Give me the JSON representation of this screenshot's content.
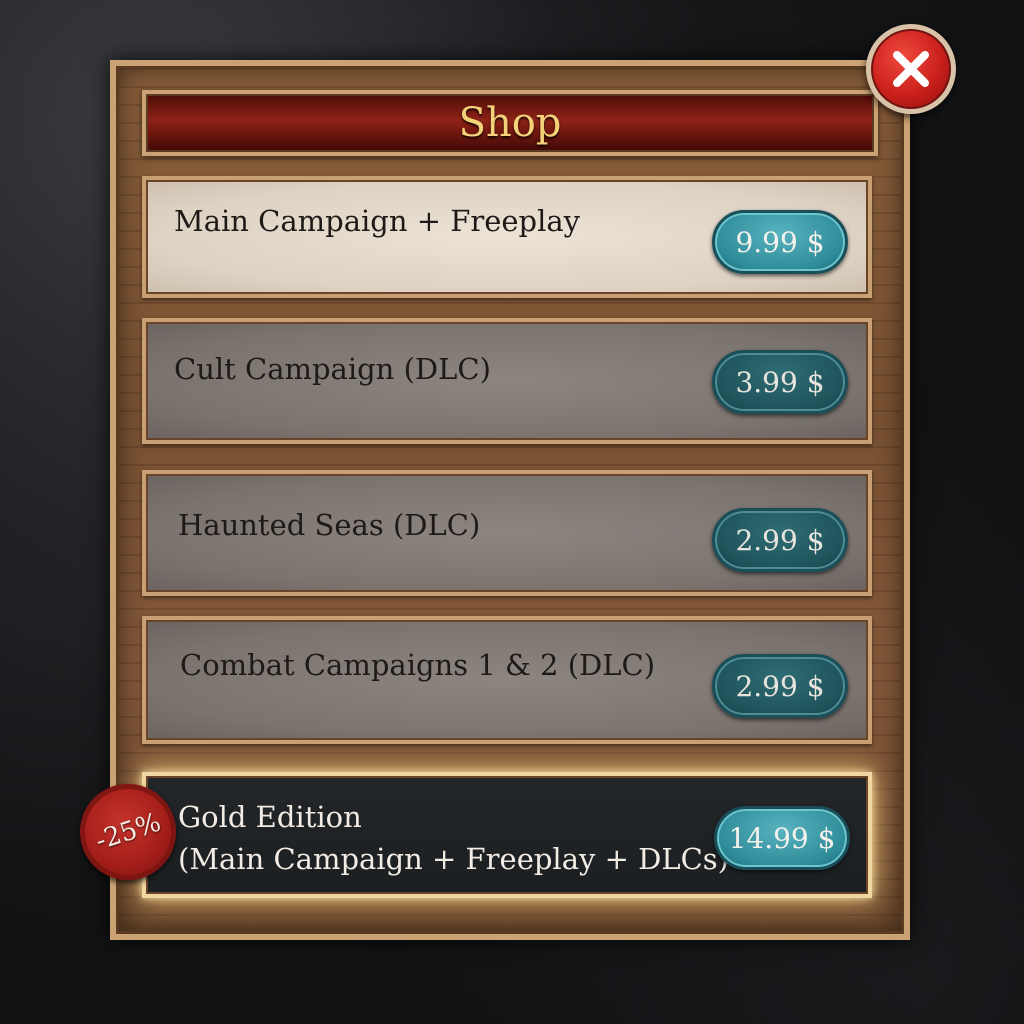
{
  "shop": {
    "title": "Shop",
    "close_icon": "close-x-icon",
    "items": [
      {
        "label": "Main Campaign + Freeplay",
        "price": "9.99 $",
        "state": "selected"
      },
      {
        "label": "Cult Campaign (DLC)",
        "price": "3.99 $",
        "state": "normal"
      },
      {
        "label": "Haunted Seas (DLC)",
        "price": "2.99 $",
        "state": "normal"
      },
      {
        "label": "Combat Campaigns 1 & 2 (DLC)",
        "price": "2.99 $",
        "state": "normal"
      },
      {
        "label_line1": "Gold Edition",
        "label_line2": "(Main Campaign + Freeplay + DLCs)",
        "price": "14.99 $",
        "discount": "-25%",
        "state": "highlighted"
      }
    ]
  },
  "colors": {
    "title_text": "#f3d27a",
    "title_bar": "#8e2316",
    "price_button": "#2f8c99",
    "close_button": "#c81f1a",
    "discount_seal": "#a41e1a"
  }
}
